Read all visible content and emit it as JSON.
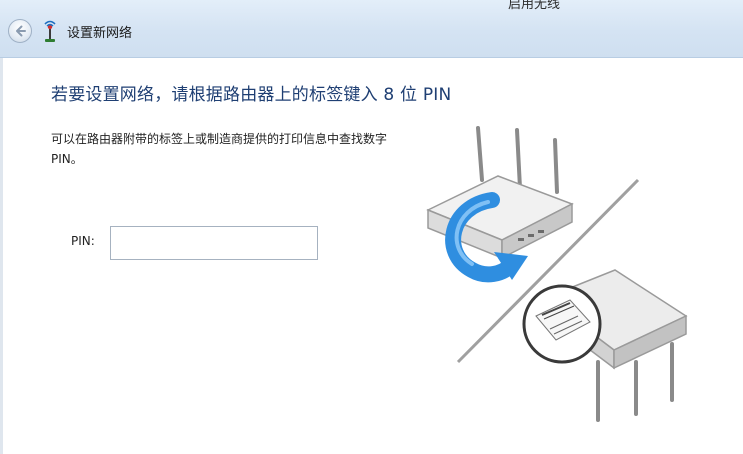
{
  "titlebar": {
    "partial_top_text": "启用无线",
    "back_icon": "back-arrow-icon",
    "network_icon": "wireless-network-icon",
    "title": "设置新网络"
  },
  "main": {
    "headline": "若要设置网络，请根据路由器上的标签键入 8 位 PIN",
    "description": "可以在路由器附带的标签上或制造商提供的打印信息中查找数字 PIN。",
    "pin": {
      "label": "PIN:",
      "value": "",
      "placeholder": ""
    }
  },
  "illustration": {
    "name": "router-pin-label-illustration",
    "accent_arrow_color": "#2f8ee0"
  }
}
